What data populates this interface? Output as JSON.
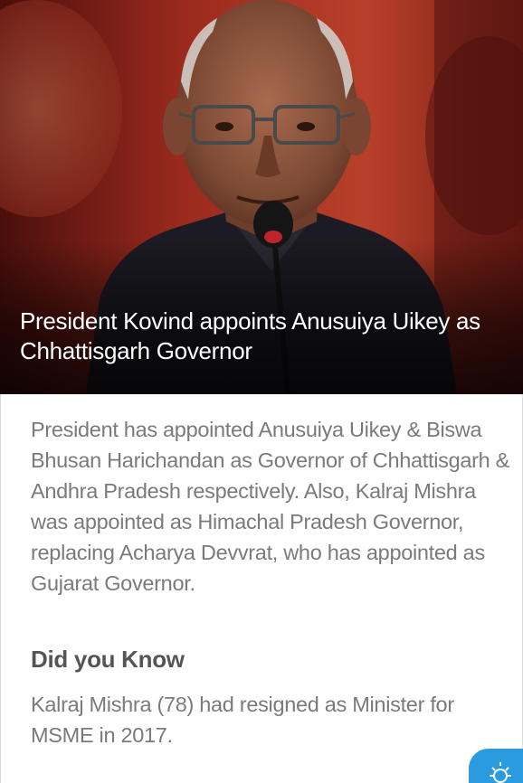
{
  "article": {
    "headline": "President Kovind appoints Anusuiya Uikey as Chhattisgarh Governor",
    "summary": "President has appointed Anusuiya Uikey & Biswa Bhusan Harichandan as Governor of Chhattisgarh & Andhra Pradesh respectively. Also, Kalraj Mishra was appointed as Himachal Pradesh Governor, replacing Acharya Devvrat, who has appointed as Gujarat Governor.",
    "did_you_know_title": "Did you Know",
    "did_you_know_text": "Kalraj Mishra (78) had resigned as Minister for MSME in 2017."
  },
  "hero_image": {
    "subject": "man-speaking-at-microphone"
  },
  "controls": {
    "brightness_icon": "sun-icon"
  },
  "colors": {
    "headline_text": "#ffffff",
    "body_text": "#7a7a7a",
    "heading_text": "#555555",
    "accent_button": "#2b9bdf"
  }
}
